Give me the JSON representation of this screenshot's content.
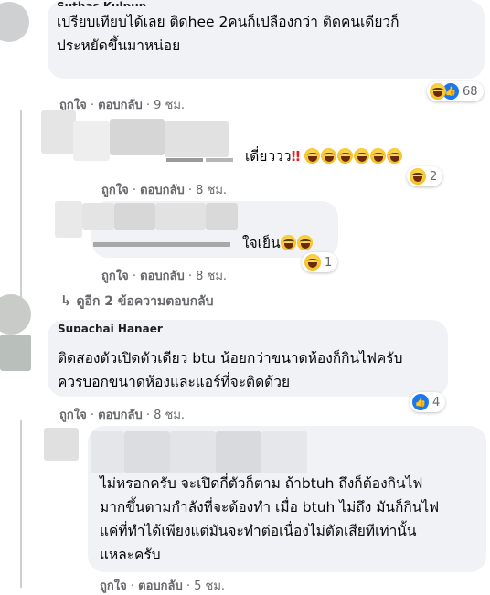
{
  "comments": [
    {
      "name_partial": "Suthas Kulpun",
      "line1": "เปรียบเทียบได้เลย ติดhee 2คนก็เปลืองกว่า ติดคนเดียวก็",
      "line2": "ประหยัดขึ้นมาหน่อย",
      "like": "ถูกใจ",
      "reply": "ตอบกลับ",
      "time": "9 ชม.",
      "reaction_count": "68"
    },
    {
      "text": "เดี่ยววว",
      "bang": "‼",
      "like": "ถูกใจ",
      "reply": "ตอบกลับ",
      "time": "8 ชม.",
      "reaction_count": "2"
    },
    {
      "text": "ใจเย็น",
      "like": "ถูกใจ",
      "reply": "ตอบกลับ",
      "time": "8 ชม.",
      "reaction_count": "1"
    },
    {
      "view_more": "ดูอีก 2 ข้อความตอบกลับ"
    },
    {
      "name_partial": "Supachai Hanaer",
      "line1": "ติดสองตัวเปิดตัวเดียว btu น้อยกว่าขนาดห้องก็กินไฟครับ",
      "line2": "ควรบอกขนาดห้องและแอร์ที่จะติดด้วย",
      "like": "ถูกใจ",
      "reply": "ตอบกลับ",
      "time": "8 ชม.",
      "reaction_count": "4"
    },
    {
      "line1": "ไม่หรอกครับ จะเปิดกี่ตัวก็ตาม ถ้าbtuh ถึงก็ต้องกินไฟ",
      "line2": "มากขึ้นตามกำลังที่จะต้องทำ เมื่อ btuh ไม่ถึง มันก็กินไฟ",
      "line3": "แค่ที่ทำได้เพียงแต่มันจะทำต่อเนื่องไม่ตัดเสียทีเท่านั้น",
      "line4": "แหละครับ",
      "like": "ถูกใจ",
      "reply": "ตอบกลับ",
      "time": "5 ชม."
    }
  ],
  "separator": " · ",
  "colors": {
    "bubble": "#f0f2f5",
    "meta": "#65676b",
    "like_blue": "#1877f2",
    "haha_yellow": "#f7c52b"
  }
}
